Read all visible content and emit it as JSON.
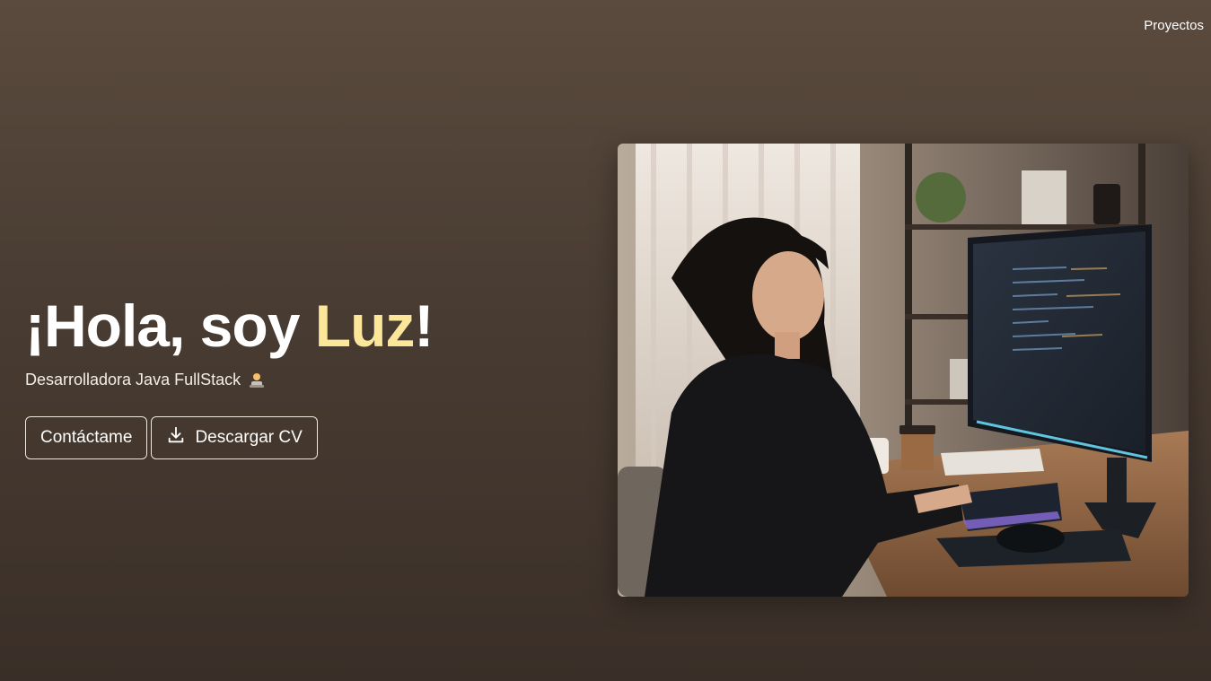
{
  "nav": {
    "projects_label": "Proyectos"
  },
  "hero": {
    "greeting_prefix": "¡Hola, soy ",
    "name": "Luz",
    "greeting_suffix": "!",
    "subtitle": "Desarrolladora Java FullStack",
    "subtitle_icon": "technologist-icon"
  },
  "buttons": {
    "contact_label": "Contáctame",
    "download_label": "Descargar CV",
    "download_icon": "download-icon"
  },
  "colors": {
    "accent_name": "#fbe69a",
    "background_top": "#5b4b3e",
    "background_bottom": "#3a2f28"
  }
}
